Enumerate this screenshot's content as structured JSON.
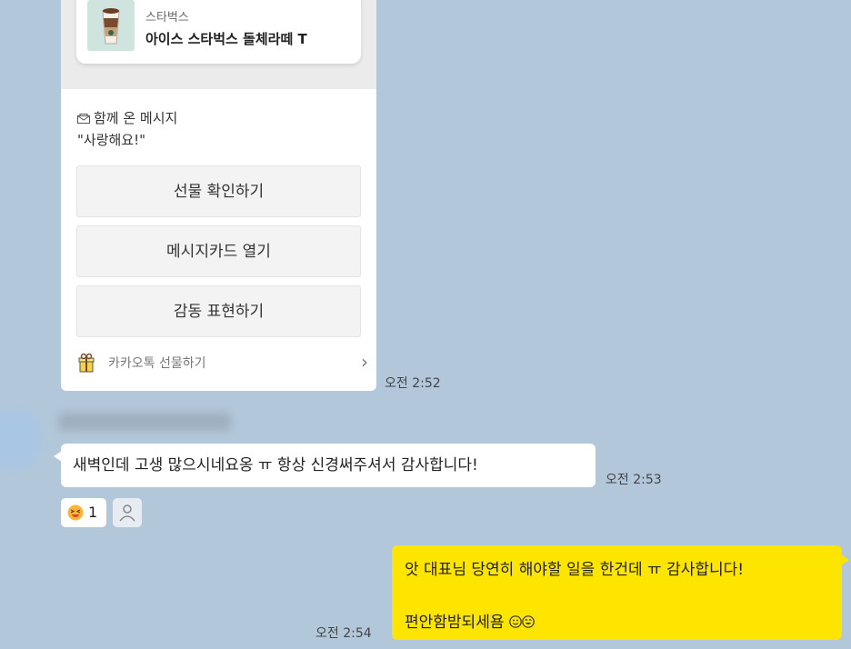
{
  "gift": {
    "brand": "스타벅스",
    "product": "아이스 스타벅스 돌체라떼 T",
    "message_title": "함께 온 메시지",
    "message": "\"사랑해요!\"",
    "buttons": [
      "선물 확인하기",
      "메시지카드 열기",
      "감동 표현하기"
    ],
    "footer_label": "카카오톡 선물하기",
    "time": "오전 2:52"
  },
  "received": {
    "text": "새벽인데 고생 많으시네요옹 ㅠ 항상 신경써주셔서 감사합니다!",
    "time": "오전 2:53",
    "reaction_count": "1"
  },
  "sent": {
    "line1": "앗 대표님 당연히 해야할 일을 한건데 ㅠ 감사합니다!",
    "line2": "편안함밤되세욤",
    "time": "오전 2:54"
  },
  "colors": {
    "background": "#b2c7da",
    "sent_bubble": "#fee500",
    "received_bubble": "#ffffff"
  }
}
